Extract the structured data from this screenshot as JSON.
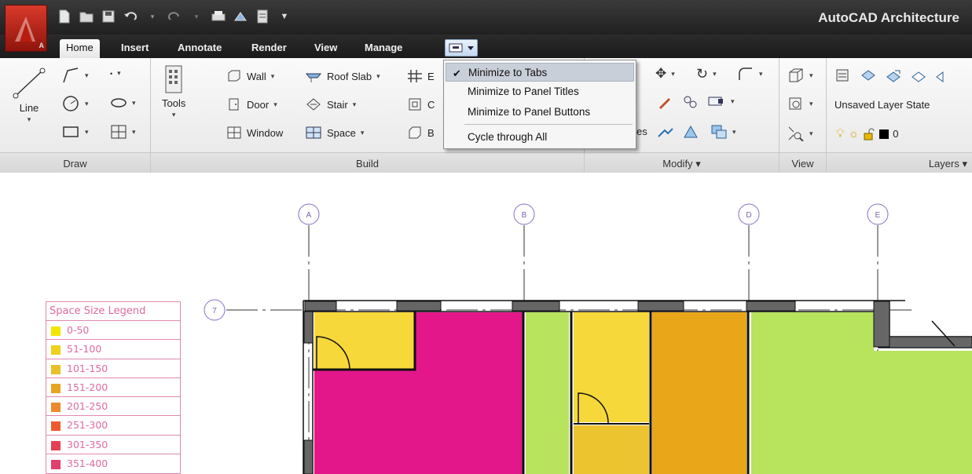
{
  "app": {
    "title": "AutoCAD Architecture",
    "logo_letter": "A"
  },
  "tabs": [
    "Home",
    "Insert",
    "Annotate",
    "Render",
    "View",
    "Manage"
  ],
  "ribbon": {
    "draw": {
      "title": "Draw",
      "line_label": "Line"
    },
    "tools": {
      "label": "Tools"
    },
    "build": {
      "title": "Build",
      "wall": "Wall",
      "door": "Door",
      "window": "Window",
      "roof_slab": "Roof Slab",
      "stair": "Stair",
      "space": "Space",
      "partial_e": "E",
      "partial_c": "C",
      "partial_b": "B",
      "partial_es": "es"
    },
    "modify": {
      "title": "Modify"
    },
    "view": {
      "title": "View"
    },
    "layers": {
      "title": "Layers",
      "layer_state": "Unsaved Layer State",
      "current_layer": "0"
    }
  },
  "menu": {
    "items": [
      "Minimize to Tabs",
      "Minimize to Panel Titles",
      "Minimize to Panel Buttons",
      "Cycle through All"
    ],
    "checked": "Minimize to Tabs",
    "check_mark": "✔"
  },
  "drawing": {
    "grid_labels": [
      "A",
      "B",
      "D",
      "E",
      "7"
    ],
    "legend": {
      "title": "Space Size Legend",
      "rows": [
        {
          "label": "0-50",
          "color": "#f2e600"
        },
        {
          "label": "51-100",
          "color": "#f0d11d"
        },
        {
          "label": "101-150",
          "color": "#e8c02a"
        },
        {
          "label": "151-200",
          "color": "#e6a420"
        },
        {
          "label": "201-250",
          "color": "#ec8a2e"
        },
        {
          "label": "251-300",
          "color": "#ee5a2e"
        },
        {
          "label": "301-350",
          "color": "#e63f54"
        },
        {
          "label": "351-400",
          "color": "#e0406e"
        }
      ]
    }
  }
}
